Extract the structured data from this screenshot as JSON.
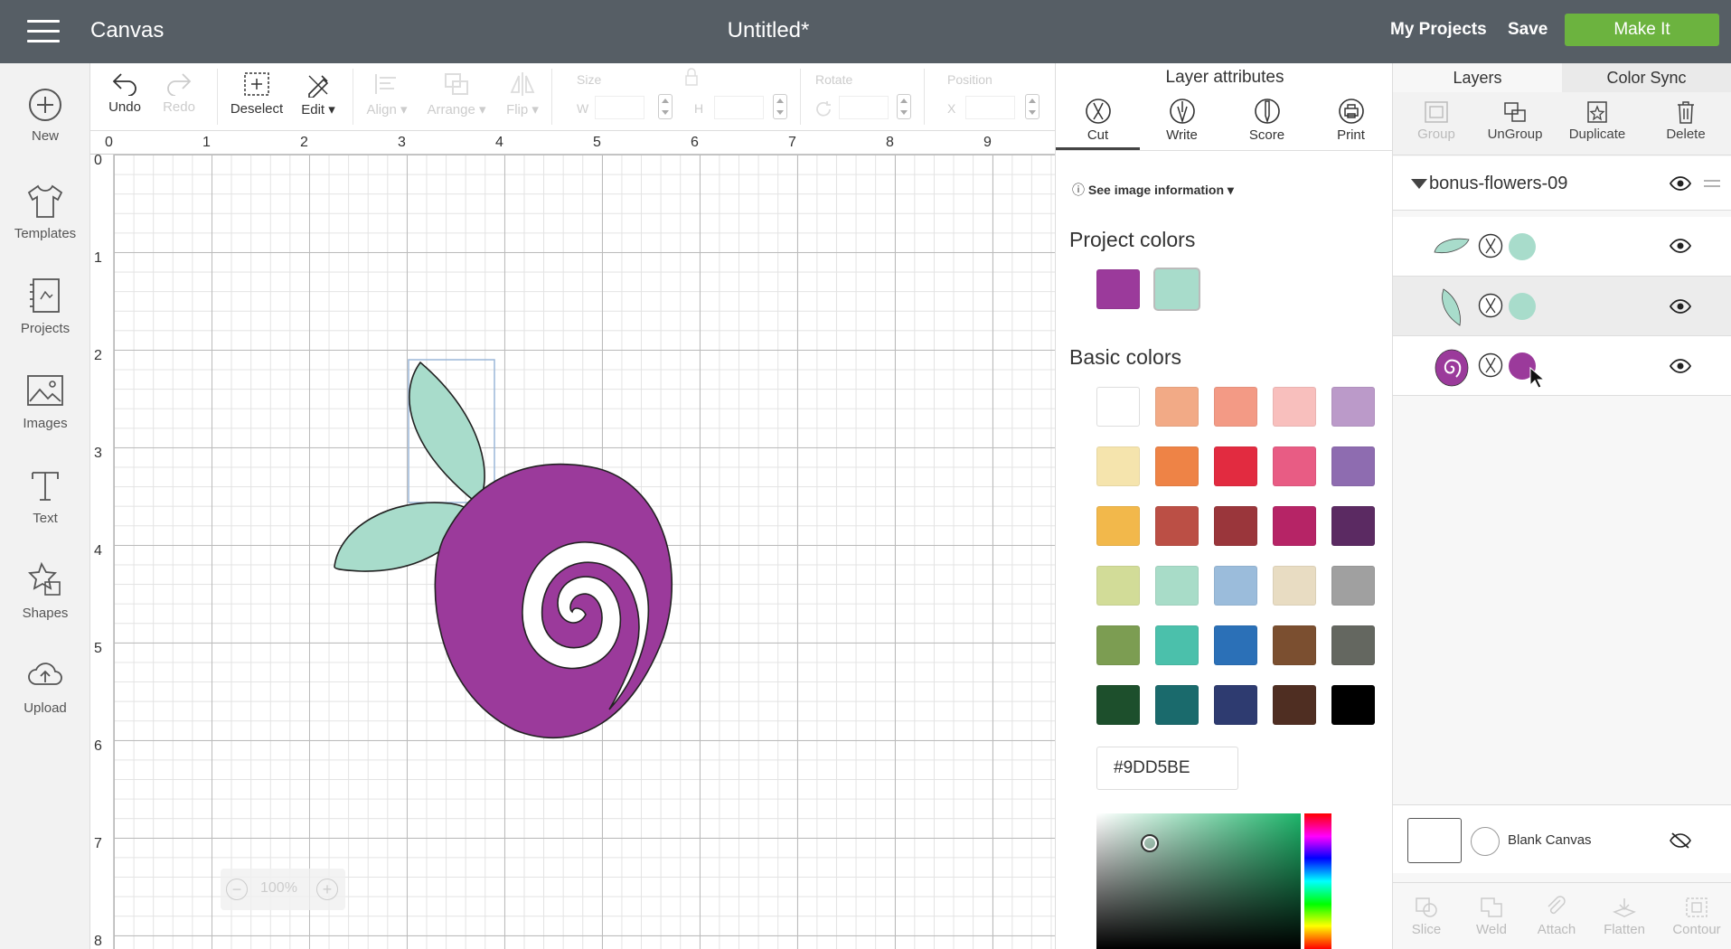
{
  "topbar": {
    "app_title": "Canvas",
    "doc_title": "Untitled*",
    "my_projects": "My Projects",
    "save": "Save",
    "make_it": "Make It"
  },
  "leftbar": {
    "items": [
      {
        "label": "New",
        "icon": "plus-circle-icon"
      },
      {
        "label": "Templates",
        "icon": "tshirt-icon"
      },
      {
        "label": "Projects",
        "icon": "projects-icon"
      },
      {
        "label": "Images",
        "icon": "image-icon"
      },
      {
        "label": "Text",
        "icon": "text-icon"
      },
      {
        "label": "Shapes",
        "icon": "shapes-icon"
      },
      {
        "label": "Upload",
        "icon": "upload-cloud-icon"
      }
    ]
  },
  "toolbar": {
    "undo": "Undo",
    "redo": "Redo",
    "deselect": "Deselect",
    "edit": "Edit",
    "align": "Align",
    "arrange": "Arrange",
    "flip": "Flip",
    "size": "Size",
    "w": "W",
    "h": "H",
    "rotate": "Rotate",
    "position": "Position",
    "x": "X"
  },
  "ruler": {
    "top": [
      "0",
      "1",
      "2",
      "3",
      "4",
      "5",
      "6",
      "7",
      "8",
      "9"
    ],
    "left": [
      "0",
      "1",
      "2",
      "3",
      "4",
      "5",
      "6",
      "7",
      "8"
    ]
  },
  "zoom": {
    "level": "100%",
    "minus": "−",
    "plus": "+"
  },
  "attributes": {
    "title": "Layer attributes",
    "tabs": [
      {
        "label": "Cut",
        "icon": "cut-blade-icon"
      },
      {
        "label": "Write",
        "icon": "pen-nib-icon"
      },
      {
        "label": "Score",
        "icon": "score-stylus-icon"
      },
      {
        "label": "Print",
        "icon": "printer-icon"
      }
    ],
    "info_icon": "ⓘ",
    "info": "See image information",
    "project_colors_title": "Project colors",
    "project_colors": [
      "#9b3a9b",
      "#a8dccb"
    ],
    "basic_colors_title": "Basic colors",
    "basic_colors": [
      [
        "#ffffff",
        "#f2aa86",
        "#f39a85",
        "#f8bfbd",
        "#bb9ac9"
      ],
      [
        "#f5e4ad",
        "#ee8346",
        "#e22b40",
        "#e85c84",
        "#8e6cb0"
      ],
      [
        "#f2b84b",
        "#bb4f45",
        "#9a363b",
        "#b62466",
        "#5b2a62"
      ],
      [
        "#d2dc98",
        "#a8dcc8",
        "#9bbcdb",
        "#e8dcc2",
        "#a0a0a0"
      ],
      [
        "#7c9d52",
        "#4bc0ab",
        "#2b70b7",
        "#7b4f30",
        "#646760"
      ],
      [
        "#1d4f2c",
        "#1a6a6c",
        "#2e3b70",
        "#4f2e22",
        "#000000"
      ]
    ],
    "hex_value": "#9DD5BE"
  },
  "layers": {
    "tabs": [
      "Layers",
      "Color Sync"
    ],
    "tools": [
      "Group",
      "UnGroup",
      "Duplicate",
      "Delete"
    ],
    "group_name": "bonus-flowers-09",
    "rows": [
      {
        "shape": "leaf-horizontal",
        "color": "#a8dccb"
      },
      {
        "shape": "leaf-vertical",
        "color": "#a8dccb"
      },
      {
        "shape": "rose",
        "color": "#9b3a9b"
      }
    ],
    "blank_canvas": "Blank Canvas",
    "bottom_tools": [
      "Slice",
      "Weld",
      "Attach",
      "Flatten",
      "Contour"
    ]
  },
  "colors": {
    "accent_green": "#6cb33f",
    "topbar": "#565e65",
    "rose": "#9b3a9b",
    "leaf": "#a8dccb"
  }
}
